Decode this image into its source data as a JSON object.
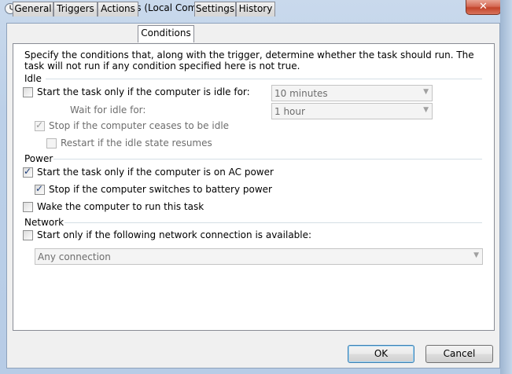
{
  "window": {
    "title": "Monthly Properties (Local Computer)",
    "close_glyph": "✕"
  },
  "tabs": [
    {
      "label": "General"
    },
    {
      "label": "Triggers"
    },
    {
      "label": "Actions"
    },
    {
      "label": "Conditions",
      "active": true
    },
    {
      "label": "Settings"
    },
    {
      "label": "History"
    }
  ],
  "description": "Specify the conditions that, along with the trigger, determine whether the task should run.  The task will not run  if any condition specified here is not true.",
  "idle": {
    "heading": "Idle",
    "start_if_idle": {
      "label": "Start the task only if the computer is idle for:",
      "checked": false
    },
    "idle_for_value": "10 minutes",
    "wait_label": "Wait for idle for:",
    "wait_value": "1 hour",
    "stop_if_not_idle": {
      "label": "Stop if the computer ceases to be idle",
      "checked": true,
      "enabled": false
    },
    "restart_if_idle": {
      "label": "Restart if the idle state resumes",
      "checked": false,
      "enabled": false
    }
  },
  "power": {
    "heading": "Power",
    "ac_power": {
      "label": "Start the task only if the computer is on AC power",
      "checked": true
    },
    "battery_stop": {
      "label": "Stop if the computer switches to battery power",
      "checked": true
    },
    "wake": {
      "label": "Wake the computer to run this task",
      "checked": false
    }
  },
  "network": {
    "heading": "Network",
    "start_if_network": {
      "label": "Start only if the following network connection is available:",
      "checked": false
    },
    "connection_value": "Any connection"
  },
  "buttons": {
    "ok": "OK",
    "cancel": "Cancel"
  },
  "icons": {
    "app": "task-scheduler-icon",
    "dropdown": "chevron-down-icon"
  }
}
